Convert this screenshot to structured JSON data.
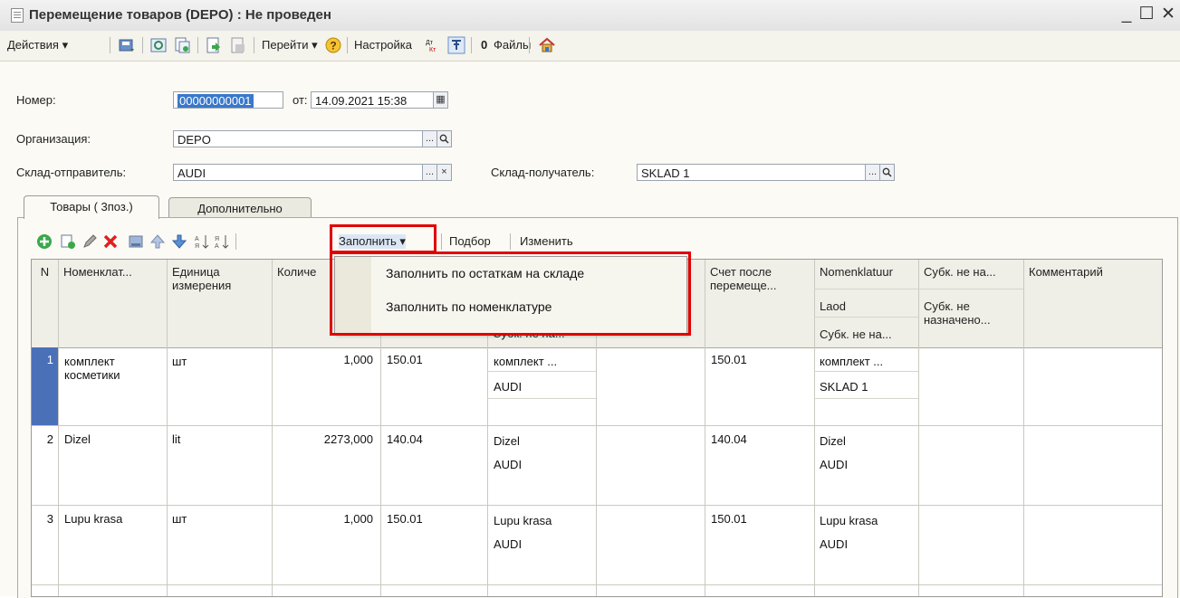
{
  "window": {
    "title": "Перемещение товаров (DEPO) : Не проведен",
    "controls": [
      "_",
      "☐",
      "✕"
    ]
  },
  "toolbar": {
    "actions_label": "Действия ▾",
    "goto_label": "Перейти ▾",
    "settings_label": "Настройка",
    "files_label": "Файлы",
    "dt_kt_label": "Дт\nКт"
  },
  "form": {
    "number_label": "Номер:",
    "number_value": "00000000001",
    "date_label": "от:",
    "date_value": "14.09.2021 15:38",
    "org_label": "Организация:",
    "org_value": "DEPO",
    "sender_label": "Склад-отправитель:",
    "sender_value": "AUDI",
    "receiver_label": "Склад-получатель:",
    "receiver_value": "SKLAD 1",
    "browse_btn": "...",
    "search_glyph": "🔍",
    "clear_glyph": "×"
  },
  "tabs": {
    "goods": "Товары ( 3поз.)",
    "extra": "Дополнительно"
  },
  "table_toolbar": {
    "fill_label": "Заполнить ▾",
    "select_label": "Подбор",
    "change_label": "Изменить"
  },
  "fill_menu": {
    "items": [
      "Заполнить по остаткам на складе",
      "Заполнить по номенклатуре"
    ]
  },
  "grid": {
    "headers": {
      "n": "N",
      "nomenclature": "Номенклат...",
      "unit": "Единица измерения",
      "qty": "Количе",
      "subk_partial": "Субк. не на...",
      "account_after": "Счет после перемеще...",
      "nomenklatuur": "Nomenklatuur",
      "laod": "Laod",
      "subk_na2": "Субк. не на...",
      "subk_top": "Субк. не на...",
      "subk_not_assigned": "Субк. не назначено...",
      "comment": "Комментарий"
    },
    "rows": [
      {
        "n": "1",
        "name": "комплект косметики",
        "unit": "шт",
        "qty": "1,000",
        "account": "150.01",
        "sub1": "комплект ...",
        "sub2": "AUDI",
        "acc_after": "150.01",
        "nk1": "комплект ...",
        "nk2": "SKLAD 1"
      },
      {
        "n": "2",
        "name": "Dizel",
        "unit": "lit",
        "qty": "2273,000",
        "account": "140.04",
        "sub1": "Dizel",
        "sub2": "AUDI",
        "acc_after": "140.04",
        "nk1": "Dizel",
        "nk2": "AUDI"
      },
      {
        "n": "3",
        "name": "Lupu krasa",
        "unit": "шт",
        "qty": "1,000",
        "account": "150.01",
        "sub1": "Lupu krasa",
        "sub2": "AUDI",
        "acc_after": "150.01",
        "nk1": "Lupu krasa",
        "nk2": "AUDI"
      }
    ]
  },
  "colors": {
    "highlight": "#e00000",
    "selection": "#3a78c9"
  }
}
